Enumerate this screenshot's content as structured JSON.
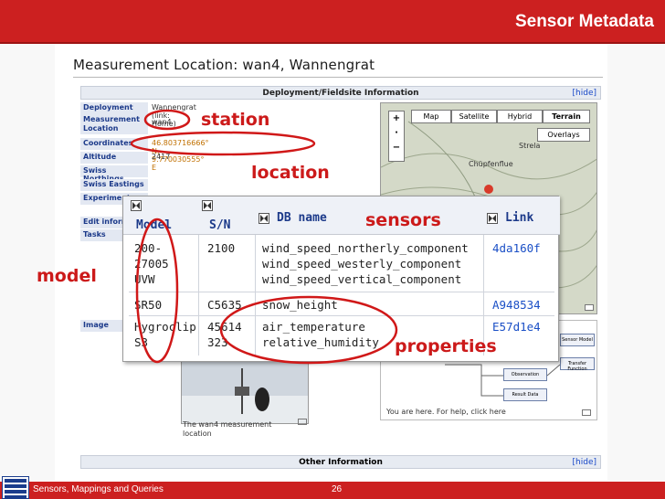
{
  "slide": {
    "title": "Sensor Metadata",
    "footer_left": "Sensors, Mappings and Queries",
    "page_number": "26"
  },
  "page": {
    "title": "Measurement Location: wan4, Wannengrat"
  },
  "deployment_panel": {
    "header": "Deployment/Fieldsite Information",
    "hide_link": "[hide]",
    "rows": [
      {
        "label": "Deployment",
        "value": "Wannengrat (link: Home)"
      },
      {
        "label": "Measurement Location",
        "value": "wan4"
      },
      {
        "label": "Coordinates",
        "value": "46.803716666° N, 9.770030555° E"
      },
      {
        "label": "Altitude",
        "value": "2417"
      },
      {
        "label": "Swiss Northings",
        "value": ""
      },
      {
        "label": "Swiss Eastings",
        "value": ""
      },
      {
        "label": "Experiment",
        "value": ""
      },
      {
        "label": "Edit inform",
        "value": ""
      },
      {
        "label": "Tasks",
        "value": ""
      },
      {
        "label": "Image",
        "value": ""
      }
    ]
  },
  "map": {
    "buttons": [
      "Map",
      "Satellite",
      "Hybrid",
      "Terrain"
    ],
    "overlays": "Overlays",
    "place_labels": [
      "Strela",
      "Chüpfenflue"
    ]
  },
  "diagram": {
    "nodes": [
      "Sensor Model",
      "Transfer Function",
      "Observation",
      "Result Data"
    ],
    "help_text": "You are here. For help, click here"
  },
  "photo": {
    "caption": "The wan4 measurement location"
  },
  "other_panel": {
    "header": "Other Information",
    "hide_link": "[hide]"
  },
  "sensor_table": {
    "columns": [
      "Model",
      "S/N",
      "DB name",
      "Link"
    ],
    "rows": [
      {
        "model": "200-\n27005\nUVW",
        "sn": "2100",
        "db_name": "wind_speed_northerly_component\nwind_speed_westerly_component\nwind_speed_vertical_component",
        "link": "4da160f"
      },
      {
        "model": "SR50",
        "sn": "C5635",
        "db_name": "snow_height",
        "link": "A948534"
      },
      {
        "model": "Hygroclip\nS3",
        "sn": "45614\n323",
        "db_name": "air_temperature\nrelative_humidity",
        "link": "E57d1e4"
      }
    ]
  },
  "annotations": {
    "station": "station",
    "location": "location",
    "sensors": "sensors",
    "model": "model",
    "properties": "properties"
  },
  "colors": {
    "brand_red": "#cc2020",
    "annotation_red": "#cc1a1a",
    "link_blue": "#1a4fc6",
    "header_blue": "#1c3a8a"
  }
}
